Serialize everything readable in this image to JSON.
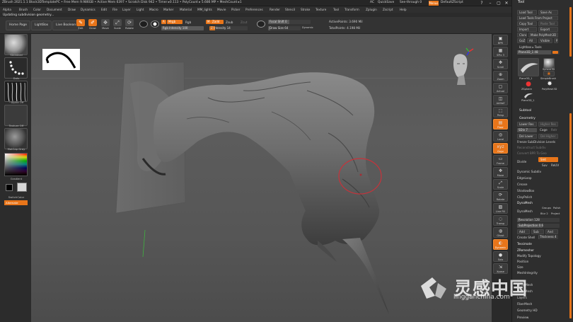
{
  "titlebar": {
    "title": "ZBrush 2021.1.1 Block3DTemplatePC  • Free Mem 9.986GB • Active Mem 6397 • Scratch Disk 942 • Timer ▸0.113 • PolyCount ▸ 5.686 MP • MeshCount ▸1",
    "ac": "AC",
    "quicksave": "QuickSave",
    "seethrough": "See-through  0",
    "menus": "Menus",
    "default_script": "DefaultZScript"
  },
  "menubar": [
    "Alpha",
    "Brush",
    "Color",
    "Document",
    "Draw",
    "Dynamics",
    "Edit",
    "File",
    "Layer",
    "Light",
    "Macro",
    "Marker",
    "Material",
    "MM_lights",
    "Movie",
    "Picker",
    "Preferences",
    "Render",
    "Stencil",
    "Stroke",
    "Texture",
    "Tool",
    "Transform",
    "Zplugin",
    "Zscript",
    "Help"
  ],
  "status": "Updating subdivision geometry...",
  "toolbar": {
    "home_page": "Home Page",
    "lightbox": "LightBox",
    "live_boolean": "Live Boolean",
    "edit": "Edit",
    "draw": "Draw",
    "move": "Move",
    "scale": "Scale",
    "rotate": "Rotate",
    "a_tag": "A",
    "mrgb": "Mrgb",
    "rgb": "Rgb",
    "rgb_intensity": "Rgb Intensity 100",
    "m_tag": "M",
    "zadd": "Zadd",
    "zsub": "Zsub",
    "zcut": "Zcut",
    "z_intensity": "Z Intensity 14",
    "focal_shift": "Focal Shift 0",
    "draw_size": "Draw Size 64",
    "dynamic": "Dynamic",
    "active_points": "ActivePoints: 3.690 Mil",
    "total_points": "TotalPoints: 4.198 Mil",
    "rgb_intensity_value": 100,
    "z_intensity_value": 14,
    "focal_shift_value": 0,
    "draw_size_value": 64
  },
  "leftshelf": {
    "standard": "Standard",
    "dots": "Dots",
    "alpha_off": "~Alpha Off",
    "texture_off": "Texture Off",
    "matcap_gray": "MatCap Gray",
    "gradient": "Gradient",
    "switch_color": "SwitchColor",
    "alternate": "Alternate"
  },
  "rightshelf": [
    {
      "label": "BPR",
      "glyph": "▣"
    },
    {
      "label": "SPix 3",
      "glyph": "▦"
    },
    {
      "label": "Scroll",
      "glyph": "✥"
    },
    {
      "label": "Zoom",
      "glyph": "⊕"
    },
    {
      "label": "Actual",
      "glyph": "▢"
    },
    {
      "label": "AAHalf",
      "glyph": "◫"
    },
    {
      "label": "Persp",
      "glyph": "⬚"
    },
    {
      "label": "Floor",
      "glyph": "▤"
    },
    {
      "label": "Local",
      "glyph": "◎"
    },
    {
      "label": "Gxyz",
      "glyph": "xyz"
    },
    {
      "label": "Frame",
      "glyph": "▭"
    },
    {
      "label": "Move",
      "glyph": "✥"
    },
    {
      "label": "Scale",
      "glyph": "⤢"
    },
    {
      "label": "Rotate",
      "glyph": "⟳"
    },
    {
      "label": "Line Fill",
      "glyph": "▨"
    },
    {
      "label": "Transp",
      "glyph": "◌"
    },
    {
      "label": "Ghost",
      "glyph": "◍"
    },
    {
      "label": "Dynamic",
      "glyph": "◐"
    },
    {
      "label": "Solo",
      "glyph": "●"
    },
    {
      "label": "Xpose",
      "glyph": "⇲"
    }
  ],
  "toolpanel": {
    "title": "Tool",
    "load_tool": "Load Tool",
    "save_as": "Save As",
    "load_tools_from_project": "Load Tools From Project",
    "copy_tool": "Copy Tool",
    "paste_tool": "Paste Tool",
    "import": "Import",
    "export": "Export",
    "clone": "Clone",
    "make_polymesh3d": "Make PolyMesh3D",
    "goz": "GoZ",
    "all": "All",
    "visible": "Visible",
    "r": "R",
    "lightbox_tools": "Lightbox ▸ Tools",
    "current_tool": "Plane3D_1   48",
    "thumbs": [
      "Plane3D_1",
      "Sphere3D",
      "SimpleBrush",
      "ZSphere",
      "PolyMesh3D",
      "Plane3D_1"
    ],
    "subtool": "Subtool",
    "geometry": "Geometry",
    "lower_res": "Lower Res",
    "higher_res": "Higher Res",
    "sdiv": "SDiv 7",
    "cage": "Cage",
    "rstr": "Rstr",
    "del_lower": "Del Lower",
    "del_higher": "Del Higher",
    "freeze_subdivision_levels": "Freeze SubDivision Levels",
    "reconstruct_subdiv": "Reconstruct Subdiv",
    "convert_bpr_to_geo": "Convert BPR To Geo",
    "divide": "Divide",
    "smt": "Smt",
    "suv": "Suv",
    "reuv": "ReUV",
    "dynamic_subdiv": "Dynamic Subdiv",
    "edgeloop": "EdgeLoop",
    "crease": "Crease",
    "shadowbox": "ShadowBox",
    "claypolish": "ClayPolish",
    "dynamesh": "DynaMesh",
    "dynamesh_btn": "DynaMesh",
    "groups": "Groups",
    "polish": "Polish",
    "blur": "Blur 2",
    "project": "Project",
    "resolution": "Resolution 128",
    "subprojection": "SubProjection 0.6",
    "add": "Add",
    "sub": "Sub",
    "and": "And",
    "create_shell": "Create Shell",
    "thickness": "Thickness 4",
    "zremesher": "ZRemesher",
    "tessimate": "Tessimate",
    "modify_topology": "Modify Topology",
    "position": "Position",
    "size": "Size",
    "meshintegrity": "MeshIntegrity",
    "arraymesh": "ArrayMesh",
    "nanomesh": "NanoMesh",
    "layers": "Layers",
    "fibermesh": "FiberMesh",
    "geometry_hd": "Geometry HD",
    "preview": "Preview",
    "sdiv_value": 7,
    "resolution_value": 128,
    "subprojection_value": 0.6,
    "thickness_value": 4
  },
  "watermark": {
    "cn": "灵感中国",
    "en": "lingganchina.com"
  },
  "colors": {
    "accent": "#e8751a",
    "panel": "#2e2e2e",
    "viewport": "#575757"
  }
}
